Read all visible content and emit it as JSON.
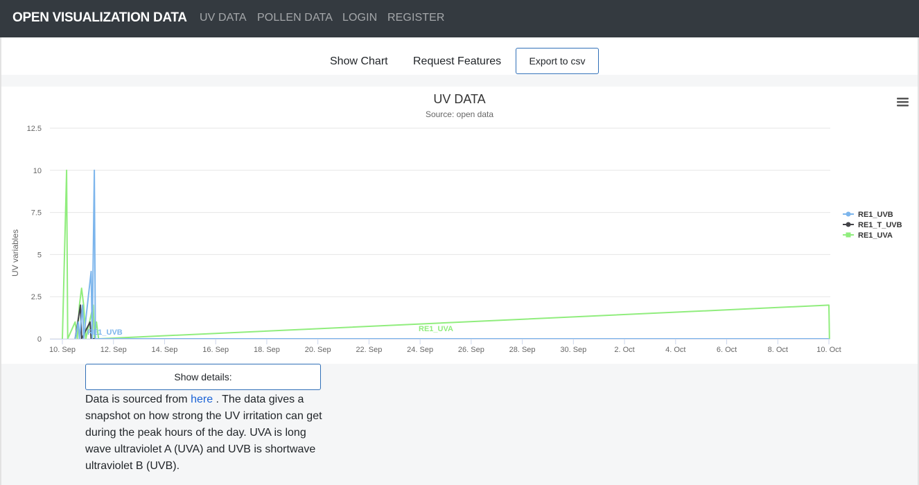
{
  "navbar": {
    "brand": "OPEN VISUALIZATION DATA",
    "links": [
      "UV DATA",
      "POLLEN DATA",
      "LOGIN",
      "REGISTER"
    ]
  },
  "toolbar": {
    "show_chart": "Show Chart",
    "request_features": "Request Features",
    "export_csv": "Export to csv"
  },
  "chart_menu_icon": "hamburger-menu-icon",
  "chart_data": {
    "type": "line",
    "title": "UV DATA",
    "subtitle": "Source: open data",
    "ylabel": "UV variables",
    "xlabel": "",
    "ylim": [
      0,
      12.5
    ],
    "xlim": [
      "2018-09-10",
      "2018-10-10"
    ],
    "x_ticks": [
      "10. Sep",
      "12. Sep",
      "14. Sep",
      "16. Sep",
      "18. Sep",
      "20. Sep",
      "22. Sep",
      "24. Sep",
      "26. Sep",
      "28. Sep",
      "30. Sep",
      "2. Oct",
      "4. Oct",
      "6. Oct",
      "8. Oct",
      "10. Oct"
    ],
    "y_ticks": [
      "0",
      "2.5",
      "5",
      "7.5",
      "10",
      "12.5"
    ],
    "grid": true,
    "legend_position": "right",
    "series": [
      {
        "name": "RE1_UVB",
        "color": "#7cb5ec",
        "label": "RE1_UVB",
        "points": [
          [
            "2018-09-10 12:00",
            0
          ],
          [
            "2018-09-10 15:00",
            1
          ],
          [
            "2018-09-10 16:00",
            0
          ],
          [
            "2018-09-10 19:00",
            2
          ],
          [
            "2018-09-10 20:00",
            0
          ],
          [
            "2018-09-11 03:00",
            4
          ],
          [
            "2018-09-11 04:00",
            0
          ],
          [
            "2018-09-11 06:00",
            10
          ],
          [
            "2018-09-11 07:00",
            0
          ],
          [
            "2018-10-10 00:00",
            0
          ]
        ]
      },
      {
        "name": "RE1_T_UVB",
        "color": "#434348",
        "points": [
          [
            "2018-09-10 12:00",
            0
          ],
          [
            "2018-09-10 17:00",
            2
          ],
          [
            "2018-09-10 18:00",
            0
          ],
          [
            "2018-09-11 02:00",
            1
          ],
          [
            "2018-09-11 03:00",
            0
          ],
          [
            "2018-10-10 00:00",
            0
          ]
        ]
      },
      {
        "name": "RE1_UVA",
        "color": "#90ed7d",
        "label": "RE1_UVA",
        "points": [
          [
            "2018-09-10 00:00",
            0
          ],
          [
            "2018-09-10 04:00",
            10
          ],
          [
            "2018-09-10 05:00",
            0
          ],
          [
            "2018-09-10 12:00",
            1
          ],
          [
            "2018-09-10 14:00",
            0
          ],
          [
            "2018-09-10 16:00",
            2
          ],
          [
            "2018-09-10 18:00",
            3
          ],
          [
            "2018-09-10 20:00",
            2
          ],
          [
            "2018-09-10 22:00",
            0
          ],
          [
            "2018-09-11 05:00",
            2
          ],
          [
            "2018-09-11 06:00",
            0
          ],
          [
            "2018-09-11 08:00",
            1
          ],
          [
            "2018-09-11 10:00",
            0
          ],
          [
            "2018-10-10 00:00",
            2
          ],
          [
            "2018-10-10 00:30",
            0
          ]
        ]
      }
    ]
  },
  "details_button": "Show details:",
  "description": {
    "before_link": "Data is sourced from ",
    "link_text": "here",
    "after_link": " . The data gives a snapshot on how strong the UV irritation can get during the peak hours of the day. UVA is long wave ultraviolet A (UVA) and UVB is shortwave ultraviolet B (UVB)."
  }
}
